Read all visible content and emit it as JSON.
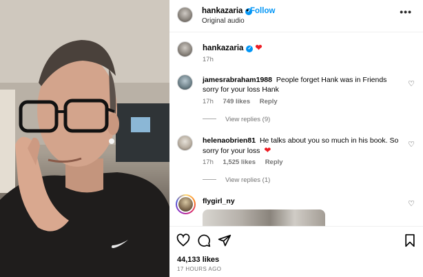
{
  "post": {
    "author": "hankazaria",
    "follow_label": "Follow",
    "separator": "•",
    "audio": "Original audio",
    "more_label": "•••"
  },
  "caption": {
    "username": "hankazaria",
    "heart": "❤",
    "time": "17h"
  },
  "comments": [
    {
      "username": "jamesrabraham1988",
      "text": "People forget Hank was in Friends sorry for your loss Hank",
      "time": "17h",
      "likes": "749 likes",
      "reply_label": "Reply",
      "view_replies": "View replies (9)"
    },
    {
      "username": "helenaobrien81",
      "text": "He talks about you so much in his book. So sorry for your loss",
      "heart": "❤",
      "time": "17h",
      "likes": "1,525 likes",
      "reply_label": "Reply",
      "view_replies": "View replies (1)"
    },
    {
      "username": "flygirl_ny"
    }
  ],
  "footer": {
    "likes": "44,133 likes",
    "timestamp": "17 HOURS AGO"
  },
  "icons": {
    "verified": "verified-badge-icon",
    "like": "heart-outline-icon",
    "comment": "comment-bubble-icon",
    "share": "paper-plane-icon",
    "save": "bookmark-icon",
    "more": "more-options-icon"
  },
  "colors": {
    "accent": "#0095f6",
    "heart_red": "#ed1c24",
    "secondary_text": "#737373"
  }
}
